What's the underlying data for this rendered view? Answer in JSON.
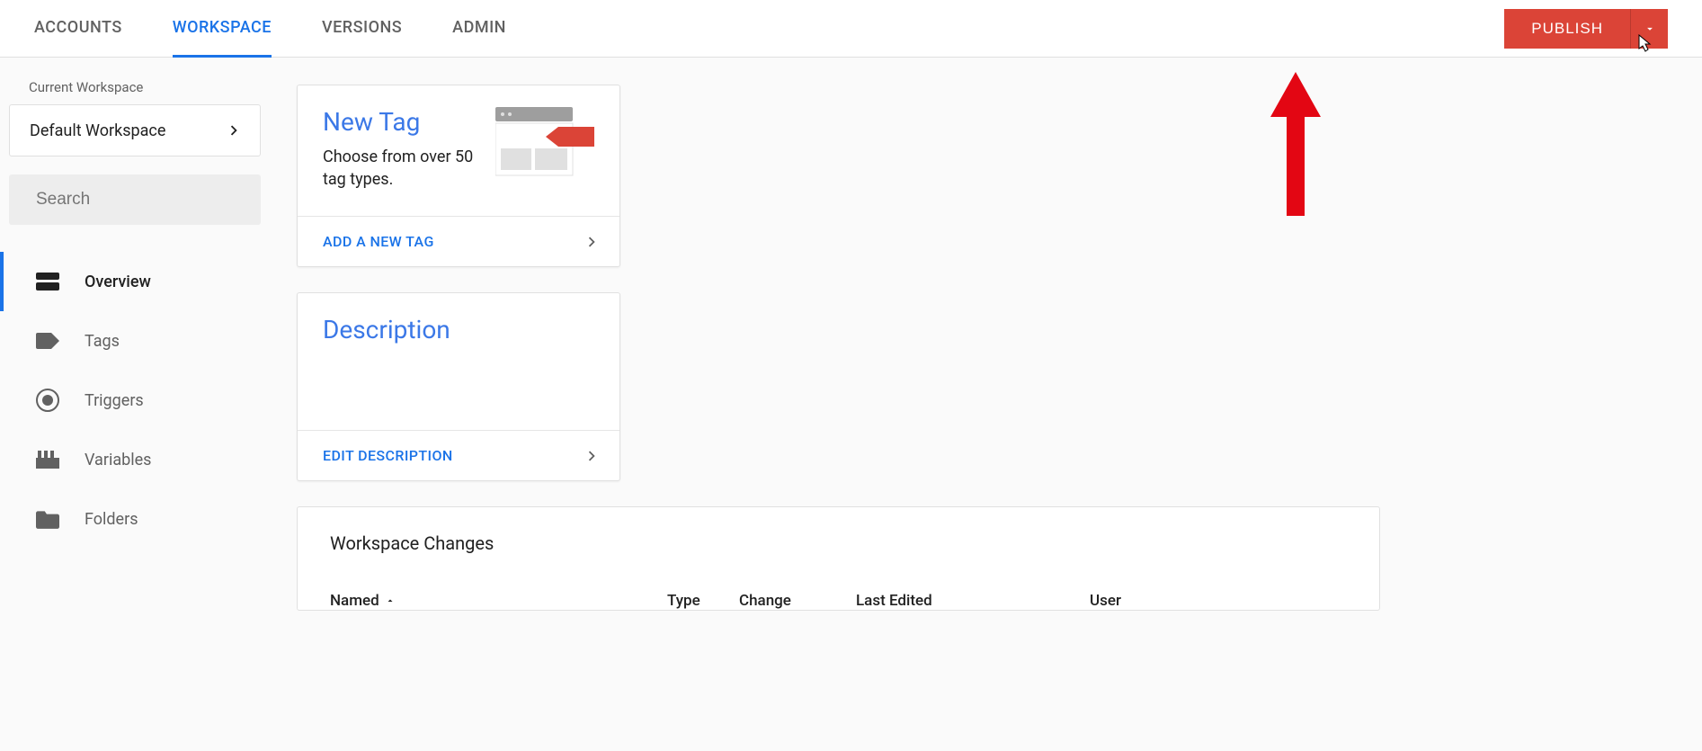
{
  "topnav": {
    "tabs": [
      "ACCOUNTS",
      "WORKSPACE",
      "VERSIONS",
      "ADMIN"
    ],
    "active_index": 1,
    "publish_label": "PUBLISH"
  },
  "sidebar": {
    "current_workspace_label": "Current Workspace",
    "workspace_name": "Default Workspace",
    "search_placeholder": "Search",
    "items": [
      {
        "label": "Overview",
        "active": true,
        "icon": "dashboard"
      },
      {
        "label": "Tags",
        "active": false,
        "icon": "label"
      },
      {
        "label": "Triggers",
        "active": false,
        "icon": "radio"
      },
      {
        "label": "Variables",
        "active": false,
        "icon": "variable"
      },
      {
        "label": "Folders",
        "active": false,
        "icon": "folder"
      }
    ]
  },
  "cards": {
    "new_tag": {
      "title": "New Tag",
      "subtitle": "Choose from over 50 tag types.",
      "action": "ADD A NEW TAG"
    },
    "description": {
      "title": "Description",
      "action": "EDIT DESCRIPTION"
    }
  },
  "changes": {
    "heading": "Workspace Changes",
    "columns": [
      "Named",
      "Type",
      "Change",
      "Last Edited",
      "User"
    ]
  }
}
